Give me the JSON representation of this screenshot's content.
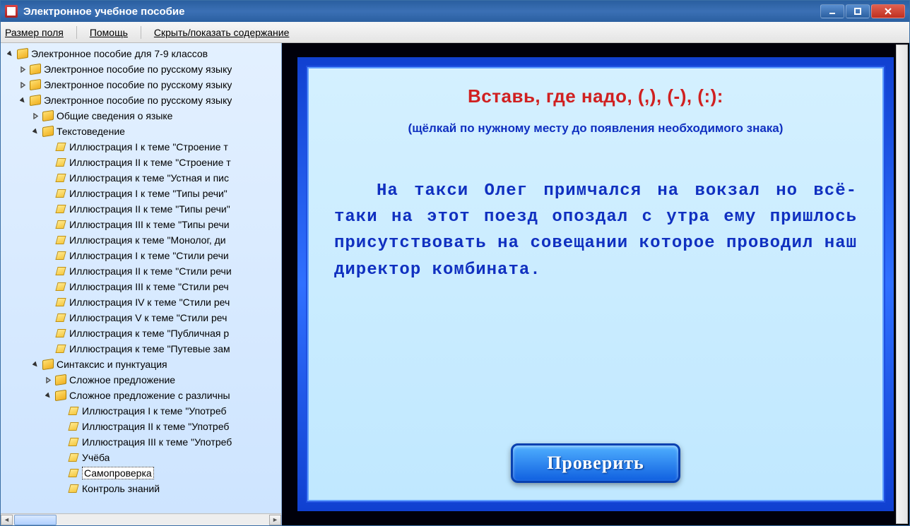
{
  "window": {
    "title": "Электронное учебное пособие"
  },
  "menu": {
    "field_size": "Размер поля",
    "help": "Помощь",
    "toggle_toc": "Скрыть/показать содержание"
  },
  "tree": {
    "root": "Электронное пособие для 7-9 классов",
    "l1a": "Электронное пособие по русскому языку",
    "l1b": "Электронное пособие по русскому языку",
    "l1c": "Электронное пособие по русскому языку",
    "l2a": "Общие сведения о языке",
    "l2b": "Текстоведение",
    "l3_items": [
      "Иллюстрация I к теме \"Строение т",
      "Иллюстрация II к теме \"Строение т",
      "Иллюстрация к теме \"Устная и пис",
      "Иллюстрация I к теме \"Типы речи\"",
      "Иллюстрация II к теме \"Типы речи\"",
      "Иллюстрация III к теме \"Типы речи",
      "Иллюстрация к теме \"Монолог, ди",
      "Иллюстрация I к теме \"Стили речи",
      "Иллюстрация II к теме \"Стили речи",
      "Иллюстрация III к теме \"Стили реч",
      "Иллюстрация IV к теме \"Стили реч",
      "Иллюстрация V к теме \"Стили реч",
      "Иллюстрация к теме \"Публичная р",
      "Иллюстрация к теме \"Путевые зам"
    ],
    "l2c": "Синтаксис и пунктуация",
    "l3a": "Сложное предложение",
    "l3b": "Сложное предложение с различны",
    "l4_items": [
      "Иллюстрация I к теме \"Употреб",
      "Иллюстрация II к теме \"Употреб",
      "Иллюстрация III к теме \"Употреб",
      "Учёба",
      "Самопроверка",
      "Контроль знаний"
    ],
    "selected_index": 4
  },
  "exercise": {
    "heading": "Вставь, где надо, (,), (-), (:):",
    "hint": "(щёлкай по нужному месту до появления необходимого знака)",
    "text": "На такси Олег примчался на вокзал но всё-таки на этот поезд опоздал с утра ему пришлось присутствовать на совещании которое проводил наш директор комбината.",
    "check_button": "Проверить"
  }
}
